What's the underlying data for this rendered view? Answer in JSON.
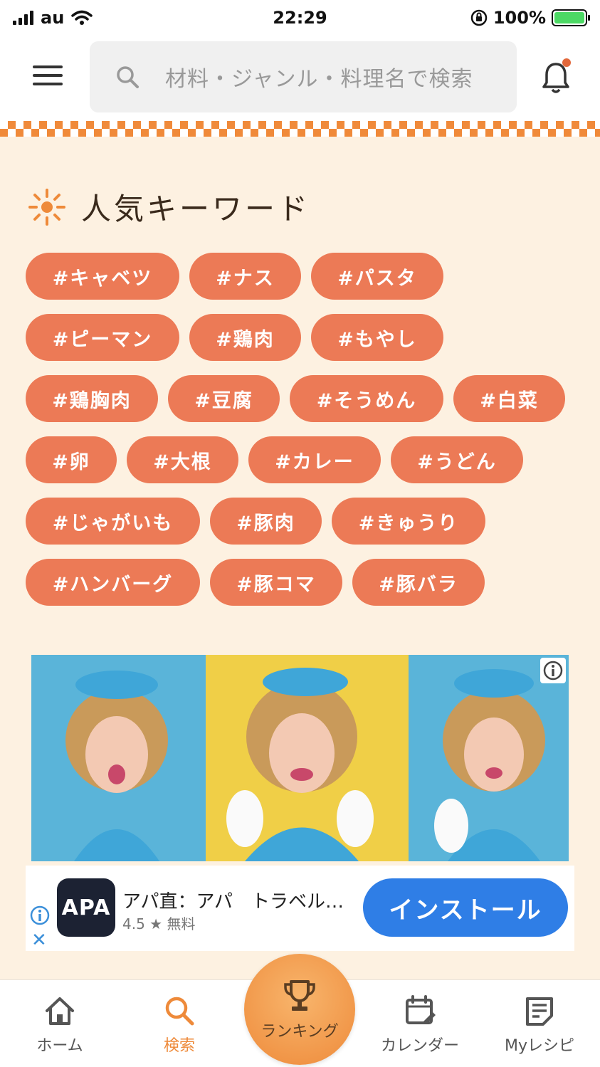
{
  "status_bar": {
    "carrier": "au",
    "time": "22:29",
    "battery": "100%"
  },
  "header": {
    "search_placeholder": "材料・ジャンル・料理名で検索"
  },
  "keywords": {
    "title": "人気キーワード",
    "rows": [
      [
        "#キャベツ",
        "#ナス",
        "#パスタ"
      ],
      [
        "#ピーマン",
        "#鶏肉",
        "#もやし"
      ],
      [
        "#鶏胸肉",
        "#豆腐",
        "#そうめん",
        "#白菜"
      ],
      [
        "#卵",
        "#大根",
        "#カレー",
        "#うどん"
      ],
      [
        "#じゃがいも",
        "#豚肉",
        "#きゅうり"
      ],
      [
        "#ハンバーグ",
        "#豚コマ",
        "#豚バラ"
      ]
    ]
  },
  "ad": {
    "logo_text": "APA",
    "app_name": "アパ直：アパ　トラベル…",
    "rating": "4.5",
    "price": "無料",
    "install_label": "インストール"
  },
  "tabbar": {
    "home": "ホーム",
    "search": "検索",
    "ranking": "ランキング",
    "calendar": "カレンダー",
    "my_recipe": "Myレシピ"
  },
  "colors": {
    "accent": "#ee8a3a",
    "tag": "#ec7a56",
    "background": "#fdf1e1",
    "install": "#2f7ee6"
  }
}
